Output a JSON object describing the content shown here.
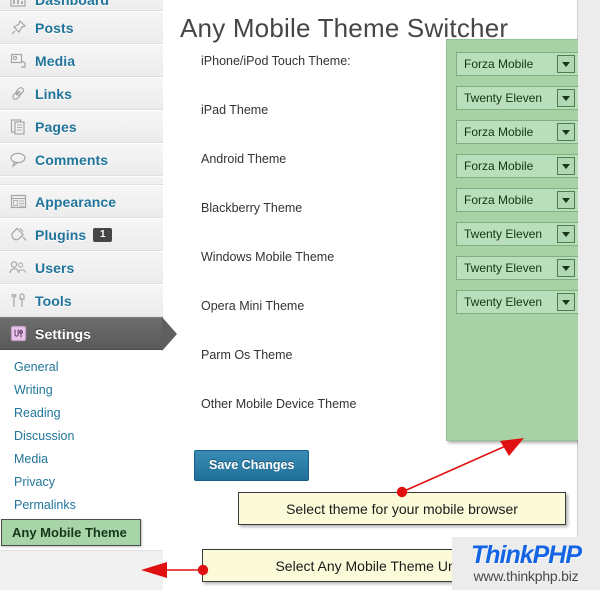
{
  "header": {
    "title": "Any Mobile Theme Switcher"
  },
  "sidebar": {
    "items": [
      {
        "label": "Dashboard",
        "icon": "dashboard-icon",
        "badge": null,
        "current": false
      },
      {
        "label": "Posts",
        "icon": "pin-icon",
        "badge": null,
        "current": false
      },
      {
        "label": "Media",
        "icon": "media-icon",
        "badge": null,
        "current": false
      },
      {
        "label": "Links",
        "icon": "link-icon",
        "badge": null,
        "current": false
      },
      {
        "label": "Pages",
        "icon": "pages-icon",
        "badge": null,
        "current": false
      },
      {
        "label": "Comments",
        "icon": "comment-bubble-icon",
        "badge": null,
        "current": false
      },
      {
        "label": "Appearance",
        "icon": "appearance-icon",
        "badge": null,
        "current": false
      },
      {
        "label": "Plugins",
        "icon": "plug-icon",
        "badge": "1",
        "current": false
      },
      {
        "label": "Users",
        "icon": "users-icon",
        "badge": null,
        "current": false
      },
      {
        "label": "Tools",
        "icon": "tools-icon",
        "badge": null,
        "current": false
      },
      {
        "label": "Settings",
        "icon": "settings-icon",
        "badge": null,
        "current": true
      }
    ],
    "submenu": [
      {
        "label": "General",
        "highlighted": false
      },
      {
        "label": "Writing",
        "highlighted": false
      },
      {
        "label": "Reading",
        "highlighted": false
      },
      {
        "label": "Discussion",
        "highlighted": false
      },
      {
        "label": "Media",
        "highlighted": false
      },
      {
        "label": "Privacy",
        "highlighted": false
      },
      {
        "label": "Permalinks",
        "highlighted": false
      },
      {
        "label": "Any Mobile Theme",
        "highlighted": true
      }
    ]
  },
  "main": {
    "theme_rows": [
      {
        "label": "iPhone/iPod Touch Theme:",
        "selected": "Forza Mobile"
      },
      {
        "label": "iPad Theme",
        "selected": "Twenty Eleven"
      },
      {
        "label": "Android Theme",
        "selected": "Forza Mobile"
      },
      {
        "label": "Blackberry Theme",
        "selected": "Forza Mobile"
      },
      {
        "label": "Windows Mobile Theme",
        "selected": "Forza Mobile"
      },
      {
        "label": "Opera Mini Theme",
        "selected": "Twenty Eleven"
      },
      {
        "label": "Parm Os Theme",
        "selected": "Twenty Eleven"
      },
      {
        "label": "Other Mobile Device Theme",
        "selected": "Twenty Eleven"
      }
    ],
    "save_label": "Save Changes"
  },
  "annotations": {
    "callout_top": "Select theme for your mobile browser",
    "callout_bottom": "Select Any Mobile Theme Und",
    "arrow_color": "#e01010"
  },
  "watermark": {
    "main": "ThinkPHP",
    "sub": "www.thinkphp.biz",
    "color": "#1464e6"
  },
  "colors": {
    "accent_blue": "#21759b",
    "green_panel": "#a6d2a6",
    "callout_yellow": "#fbfbd9",
    "save_button": "#21759b",
    "current_menu": "#5f5f5f"
  }
}
